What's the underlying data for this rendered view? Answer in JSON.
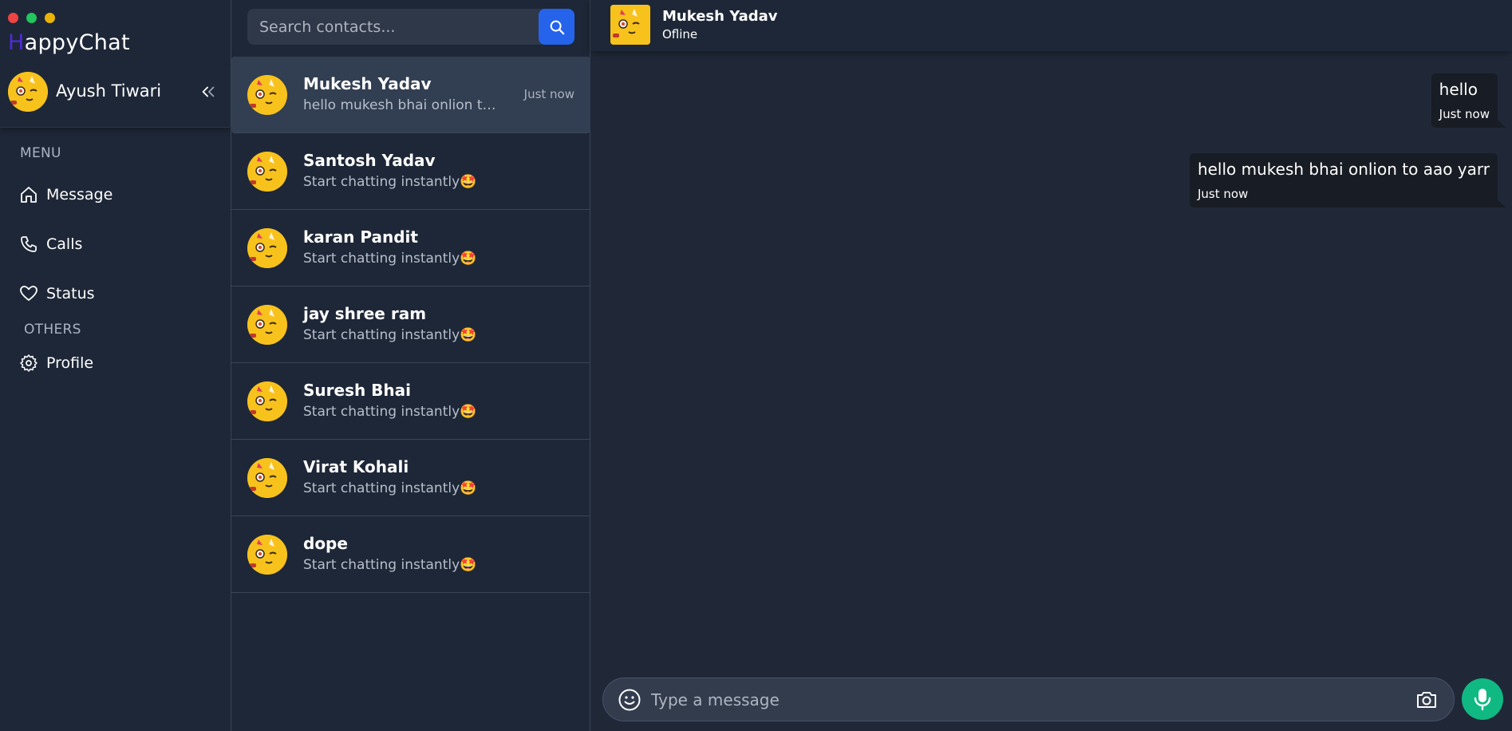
{
  "app": {
    "brand_first": "H",
    "brand_rest": "appyChat",
    "colors": {
      "accent_blue": "#2563eb",
      "mic_green": "#10b981",
      "brand_first_letter": "#4f2bd6"
    }
  },
  "sidebar": {
    "user_name": "Ayush Tiwari",
    "menu_heading": "MENU",
    "others_heading": "OTHERS",
    "items": [
      {
        "label": "Message",
        "icon": "home-icon"
      },
      {
        "label": "Calls",
        "icon": "phone-icon"
      },
      {
        "label": "Status",
        "icon": "heart-icon"
      },
      {
        "label": "Profile",
        "icon": "gear-icon"
      }
    ]
  },
  "search": {
    "placeholder": "Search contacts..."
  },
  "contacts": [
    {
      "name": "Mukesh Yadav",
      "preview": "hello mukesh bhai onlion to aao yarr",
      "time": "Just now",
      "active": true
    },
    {
      "name": "Santosh Yadav",
      "preview": "Start chatting instantly🤩",
      "time": ""
    },
    {
      "name": "karan Pandit",
      "preview": "Start chatting instantly🤩",
      "time": ""
    },
    {
      "name": "jay shree ram",
      "preview": "Start chatting instantly🤩",
      "time": ""
    },
    {
      "name": "Suresh Bhai",
      "preview": "Start chatting instantly🤩",
      "time": ""
    },
    {
      "name": "Virat Kohali",
      "preview": "Start chatting instantly🤩",
      "time": ""
    },
    {
      "name": "dope",
      "preview": "Start chatting instantly🤩",
      "time": ""
    }
  ],
  "chat": {
    "contact_name": "Mukesh Yadav",
    "status": "Ofline",
    "messages": [
      {
        "text": "hello",
        "time": "Just now"
      },
      {
        "text": "hello mukesh bhai onlion to aao yarr",
        "time": "Just now"
      }
    ],
    "composer_placeholder": "Type a message"
  }
}
